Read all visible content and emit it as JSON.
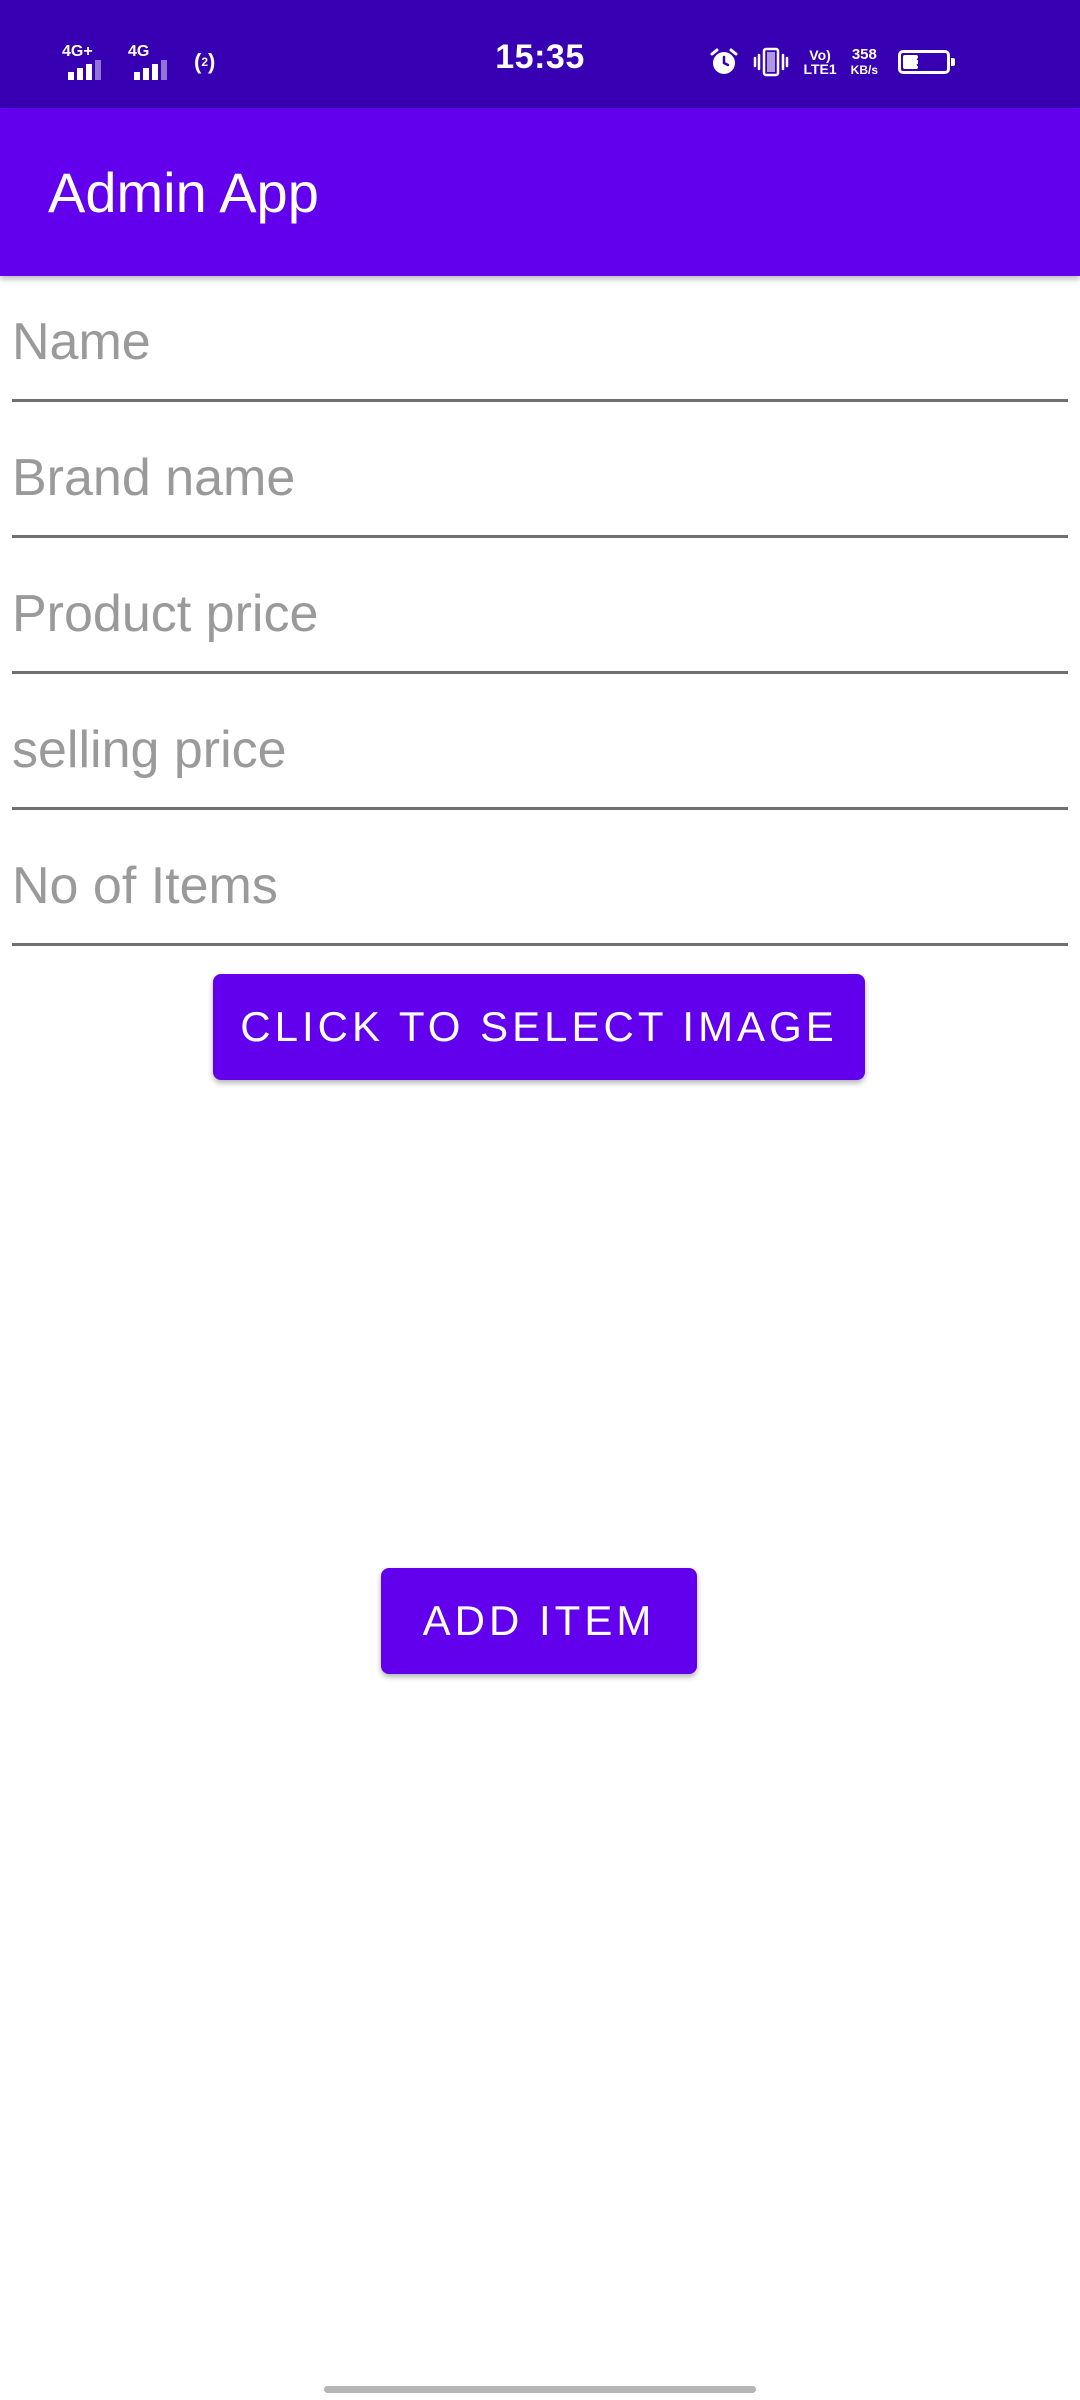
{
  "status_bar": {
    "time": "15:35",
    "network_1": "4G+",
    "network_2": "4G",
    "hotspot_badge": "2",
    "volte": "Vo)",
    "lte": "LTE1",
    "speed_value": "358",
    "speed_unit": "KB/s",
    "battery_level": "36",
    "battery_fraction": 0.36
  },
  "app_bar": {
    "title": "Admin App"
  },
  "form": {
    "fields": [
      {
        "placeholder": "Name",
        "value": ""
      },
      {
        "placeholder": "Brand name",
        "value": ""
      },
      {
        "placeholder": "Product price",
        "value": ""
      },
      {
        "placeholder": "selling price",
        "value": ""
      },
      {
        "placeholder": "No of Items",
        "value": ""
      }
    ],
    "select_image_label": "Click to select image",
    "add_item_label": "Add item"
  },
  "colors": {
    "status_bar": "#3700B3",
    "primary": "#6200EE",
    "underline": "#6F6F6F",
    "placeholder": "#9A9A9A"
  },
  "icons": {
    "alarm": "alarm-clock-icon",
    "vibrate": "vibrate-icon",
    "hotspot": "hotspot-icon",
    "signal": "signal-bars-icon",
    "battery": "battery-icon"
  }
}
